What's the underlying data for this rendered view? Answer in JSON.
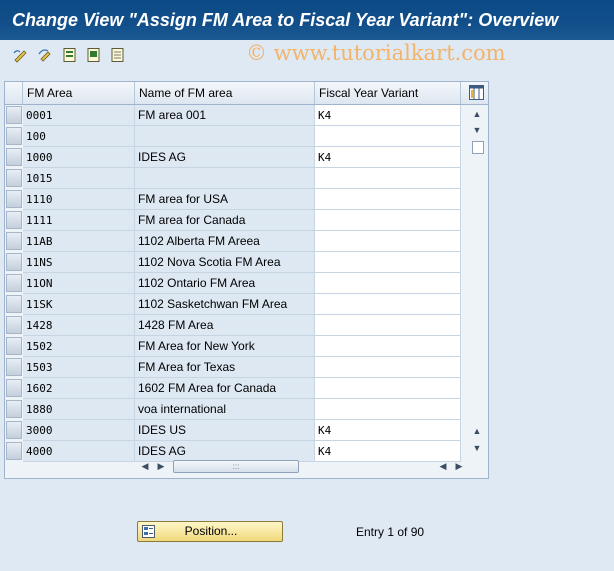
{
  "window": {
    "title": "Change View \"Assign FM Area to Fiscal Year Variant\": Overview",
    "watermark": "© www.tutorialkart.com"
  },
  "toolbar": {
    "buttons": [
      {
        "icon": "display-change-icon"
      },
      {
        "icon": "undo-change-icon"
      },
      {
        "icon": "select-all-icon"
      },
      {
        "icon": "select-block-icon"
      },
      {
        "icon": "deselect-all-icon"
      }
    ]
  },
  "table": {
    "columns": [
      "FM Area",
      "Name of FM area",
      "Fiscal Year Variant"
    ],
    "rows": [
      {
        "fm_area": "0001",
        "name": "FM area 001",
        "fyv": "K4"
      },
      {
        "fm_area": "100",
        "name": "",
        "fyv": ""
      },
      {
        "fm_area": "1000",
        "name": "IDES AG",
        "fyv": "K4"
      },
      {
        "fm_area": "1015",
        "name": "",
        "fyv": ""
      },
      {
        "fm_area": "1110",
        "name": "FM area for USA",
        "fyv": ""
      },
      {
        "fm_area": "1111",
        "name": "FM area for Canada",
        "fyv": ""
      },
      {
        "fm_area": "11AB",
        "name": "1102 Alberta FM Areea",
        "fyv": ""
      },
      {
        "fm_area": "11NS",
        "name": "1102 Nova Scotia FM Area",
        "fyv": ""
      },
      {
        "fm_area": "11ON",
        "name": "1102 Ontario FM Area",
        "fyv": ""
      },
      {
        "fm_area": "11SK",
        "name": "1102 Sasketchwan FM Area",
        "fyv": ""
      },
      {
        "fm_area": "1428",
        "name": "1428 FM Area",
        "fyv": ""
      },
      {
        "fm_area": "1502",
        "name": "FM Area for New York",
        "fyv": ""
      },
      {
        "fm_area": "1503",
        "name": "FM Area for Texas",
        "fyv": ""
      },
      {
        "fm_area": "1602",
        "name": "1602 FM Area for Canada",
        "fyv": ""
      },
      {
        "fm_area": "1880",
        "name": "voa international",
        "fyv": ""
      },
      {
        "fm_area": "3000",
        "name": "IDES US",
        "fyv": "K4"
      },
      {
        "fm_area": "4000",
        "name": "IDES AG",
        "fyv": "K4"
      }
    ]
  },
  "footer": {
    "position_label": "Position...",
    "entry_text": "Entry 1 of 90"
  }
}
